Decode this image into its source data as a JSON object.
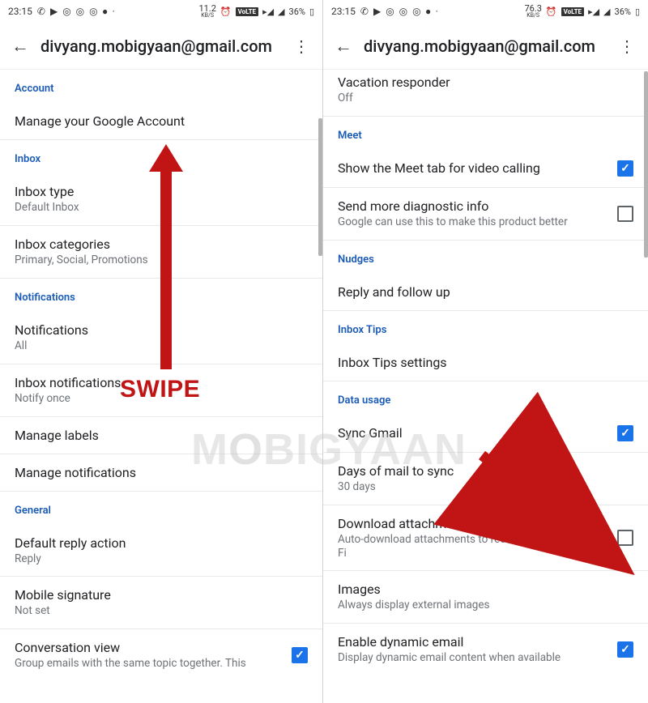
{
  "status": {
    "time": "23:15",
    "kbs_left": "11.2",
    "kbs_right": "76.3",
    "kbs_unit": "KB/S",
    "volte": "VoLTE",
    "battery": "36%"
  },
  "left": {
    "title": "divyang.mobigyaan@gmail.com",
    "sections": {
      "account": {
        "header": "Account",
        "manage": "Manage your Google Account"
      },
      "inbox": {
        "header": "Inbox",
        "type_title": "Inbox type",
        "type_sub": "Default Inbox",
        "cat_title": "Inbox categories",
        "cat_sub": "Primary, Social, Promotions"
      },
      "notifications": {
        "header": "Notifications",
        "notif_title": "Notifications",
        "notif_sub": "All",
        "inboxnotif_title": "Inbox notifications",
        "inboxnotif_sub": "Notify once",
        "labels": "Manage labels",
        "manage": "Manage notifications"
      },
      "general": {
        "header": "General",
        "reply_title": "Default reply action",
        "reply_sub": "Reply",
        "sig_title": "Mobile signature",
        "sig_sub": "Not set",
        "conv_title": "Conversation view",
        "conv_sub": "Group emails with the same topic together. This"
      }
    }
  },
  "right": {
    "title": "divyang.mobigyaan@gmail.com",
    "vacation_title": "Vacation responder",
    "vacation_sub": "Off",
    "meet": {
      "header": "Meet",
      "show_title": "Show the Meet tab for video calling",
      "diag_title": "Send more diagnostic info",
      "diag_sub": "Google can use this to make this product better"
    },
    "nudges": {
      "header": "Nudges",
      "title": "Reply and follow up"
    },
    "tips": {
      "header": "Inbox Tips",
      "title": "Inbox Tips settings"
    },
    "data": {
      "header": "Data usage",
      "sync_title": "Sync Gmail",
      "days_title": "Days of mail to sync",
      "days_sub": "30 days",
      "dl_title": "Download attachments",
      "dl_sub": "Auto-download attachments to recent messages via Wi-Fi",
      "img_title": "Images",
      "img_sub": "Always display external images",
      "dyn_title": "Enable dynamic email",
      "dyn_sub": "Display dynamic email content when available"
    }
  },
  "annotation": {
    "swipe": "SWIPE",
    "watermark": "MOBIGYAAN"
  }
}
